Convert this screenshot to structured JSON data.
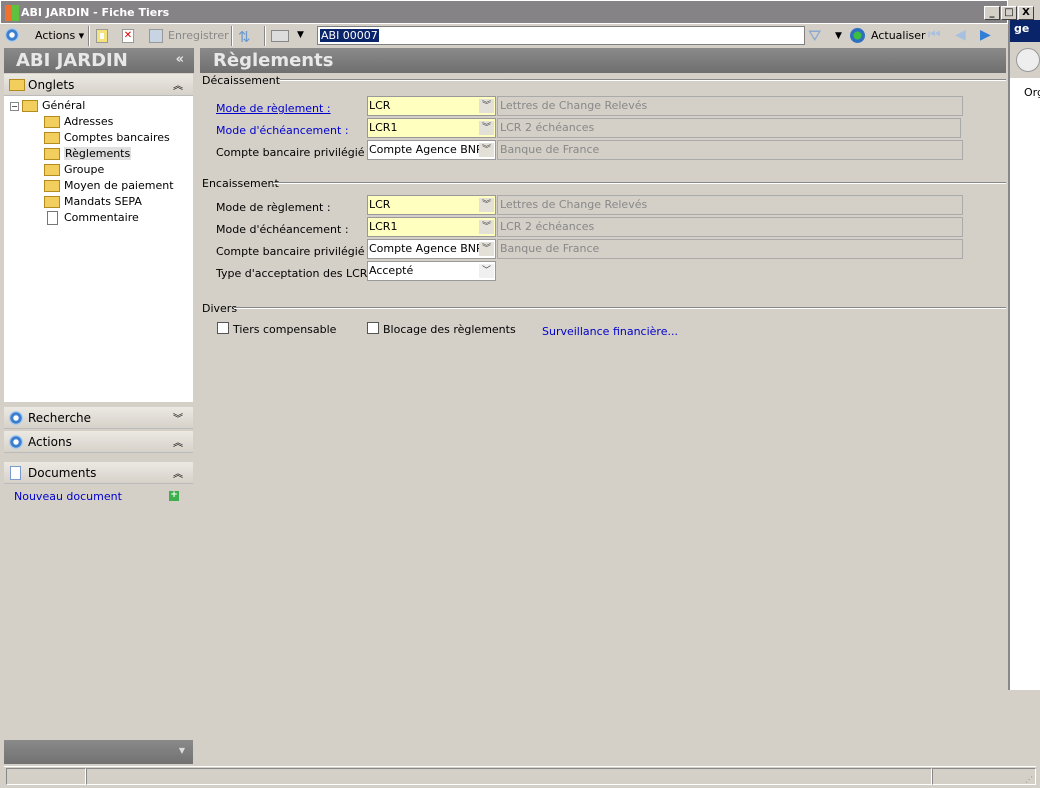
{
  "window": {
    "title": "ABI JARDIN - Fiche Tiers",
    "minimize": "_",
    "maximize": "□",
    "close": "X"
  },
  "toolbar": {
    "actions": "Actions",
    "save": "Enregistrer",
    "search_value": "ABI 00007",
    "refresh": "Actualiser"
  },
  "sidebar": {
    "company": "ABI JARDIN",
    "collapse": "«",
    "tabs_title": "Onglets",
    "tree": {
      "root": "Général",
      "items": [
        "Adresses",
        "Comptes bancaires",
        "Règlements",
        "Groupe",
        "Moyen de paiement",
        "Mandats SEPA",
        "Commentaire"
      ]
    },
    "search_panel": "Recherche",
    "actions_panel": "Actions",
    "documents_panel": "Documents",
    "new_document": "Nouveau document"
  },
  "main": {
    "title": "Règlements",
    "decaissement": {
      "title": "Décaissement",
      "mode_reglement": {
        "label": "Mode de règlement :",
        "value": "LCR",
        "desc": "Lettres de Change Relevés"
      },
      "mode_echeance": {
        "label": "Mode d'échéancement :",
        "value": "LCR1",
        "desc": "LCR 2 échéances"
      },
      "compte": {
        "label": "Compte bancaire privilégié :",
        "value": "Compte Agence BNP",
        "desc": "Banque de France"
      }
    },
    "encaissement": {
      "title": "Encaissement",
      "mode_reglement": {
        "label": "Mode de règlement :",
        "value": "LCR",
        "desc": "Lettres de Change Relevés"
      },
      "mode_echeance": {
        "label": "Mode d'échéancement :",
        "value": "LCR1",
        "desc": "LCR 2 échéances"
      },
      "compte": {
        "label": "Compte bancaire privilégié :",
        "value": "Compte Agence BNP",
        "desc": "Banque de France"
      },
      "acceptation": {
        "label": "Type d'acceptation des LCR:",
        "value": "Accepté"
      }
    },
    "divers": {
      "title": "Divers",
      "tiers_compensable": "Tiers compensable",
      "blocage": "Blocage des règlements",
      "surveillance": "Surveillance financière..."
    }
  },
  "right_window": {
    "title": "ge",
    "org": "Org"
  }
}
